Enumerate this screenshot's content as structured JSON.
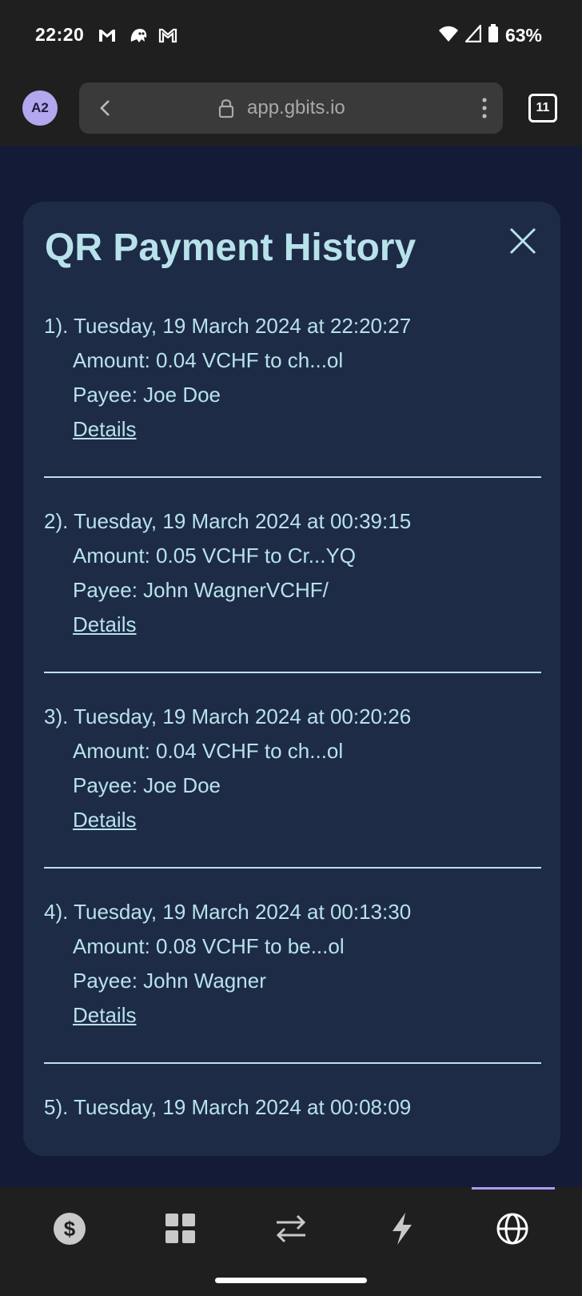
{
  "status_bar": {
    "time": "22:20",
    "battery": "63%",
    "left_icons": [
      "gmail-icon",
      "ghost-icon",
      "gmail-icon"
    ],
    "right_icons": [
      "wifi-icon",
      "signal-icon",
      "battery-icon"
    ]
  },
  "browser": {
    "avatar": "A2",
    "url": "app.gbits.io",
    "tab_count": "11"
  },
  "modal": {
    "title": "QR Payment History",
    "entries": [
      {
        "when": "1). Tuesday, 19 March 2024 at 22:20:27",
        "amount": "Amount: 0.04 VCHF to ch...ol",
        "payee": "Payee: Joe Doe",
        "details": "Details"
      },
      {
        "when": "2). Tuesday, 19 March 2024 at 00:39:15",
        "amount": "Amount: 0.05 VCHF to Cr...YQ",
        "payee": "Payee: John WagnerVCHF/",
        "details": "Details"
      },
      {
        "when": "3). Tuesday, 19 March 2024 at 00:20:26",
        "amount": "Amount: 0.04 VCHF to ch...ol",
        "payee": "Payee: Joe Doe",
        "details": "Details"
      },
      {
        "when": "4). Tuesday, 19 March 2024 at 00:13:30",
        "amount": "Amount: 0.08 VCHF to be...ol",
        "payee": "Payee: John Wagner",
        "details": "Details"
      },
      {
        "when": "5). Tuesday, 19 March 2024 at 00:08:09"
      }
    ]
  },
  "bottom_nav": {
    "items": [
      "dollar-icon",
      "grid-icon",
      "transfer-icon",
      "lightning-icon",
      "globe-icon"
    ],
    "active": "globe-icon"
  },
  "colors": {
    "page_bg": "#141b36",
    "card_bg": "#1d2b47",
    "text": "#b8e2ea",
    "accent": "#a99cf0"
  }
}
